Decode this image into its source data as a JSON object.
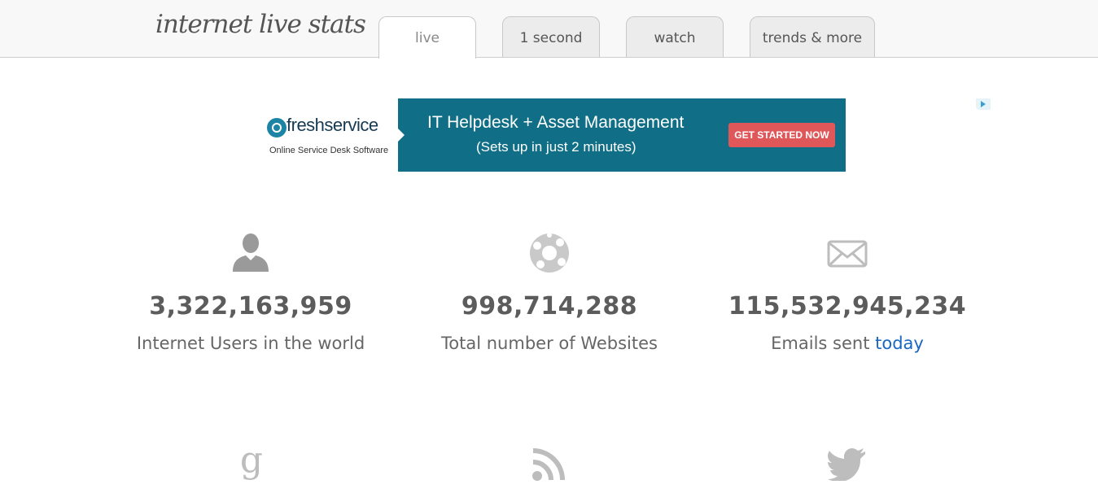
{
  "header": {
    "logo": "internet live stats",
    "tabs": [
      {
        "label": "live",
        "active": true
      },
      {
        "label": "1 second",
        "active": false
      },
      {
        "label": "watch",
        "active": false
      },
      {
        "label": "trends & more",
        "active": false
      }
    ]
  },
  "ad": {
    "brand": "freshservice",
    "tagline": "Online Service Desk Software",
    "headline": "IT Helpdesk + Asset Management",
    "subline": "(Sets up in just 2 minutes)",
    "cta": "GET STARTED NOW",
    "colors": {
      "panel": "#106f87",
      "cta": "#e0575a"
    }
  },
  "stats": [
    {
      "icon": "user-icon",
      "value": "3,322,163,959",
      "label": "Internet Users in the world"
    },
    {
      "icon": "globe-icon",
      "value": "998,714,288",
      "label": "Total number of Websites"
    },
    {
      "icon": "envelope-icon",
      "value": "115,532,945,234",
      "label_prefix": "Emails sent ",
      "label_link": "today"
    }
  ],
  "bottom_icons": [
    "google-icon",
    "rss-icon",
    "twitter-icon"
  ]
}
